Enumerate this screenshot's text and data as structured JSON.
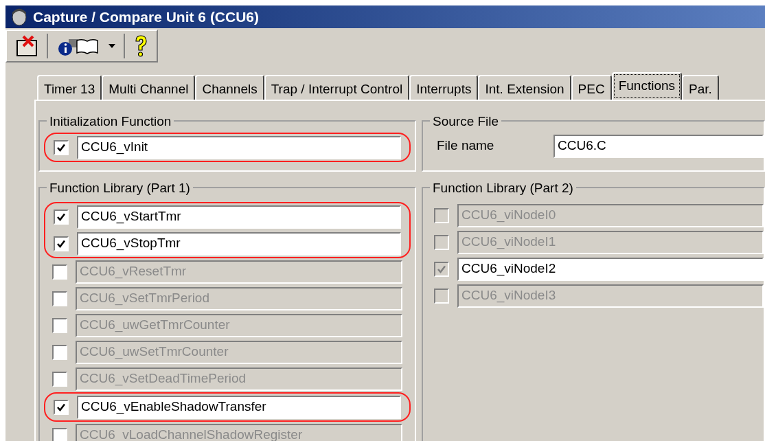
{
  "window": {
    "title": "Capture / Compare Unit 6 (CCU6)"
  },
  "tabs": [
    {
      "label": "Timer 13",
      "selected": false
    },
    {
      "label": "Multi Channel",
      "selected": false
    },
    {
      "label": "Channels",
      "selected": false
    },
    {
      "label": "Trap / Interrupt Control",
      "selected": false
    },
    {
      "label": "Interrupts",
      "selected": false
    },
    {
      "label": "Int. Extension",
      "selected": false
    },
    {
      "label": "PEC",
      "selected": false
    },
    {
      "label": "Functions",
      "selected": true
    },
    {
      "label": "Par.",
      "selected": false
    }
  ],
  "initialization": {
    "title": "Initialization Function",
    "rows": [
      {
        "name": "CCU6_vInit",
        "checked": true,
        "disabled": false,
        "highlighted": true
      }
    ]
  },
  "source_file": {
    "title": "Source File",
    "label": "File name",
    "value": "CCU6.C"
  },
  "library_part1": {
    "title": "Function Library (Part 1)",
    "rows": [
      {
        "name": "CCU6_vStartTmr",
        "checked": true,
        "disabled": false,
        "highlighted": true
      },
      {
        "name": "CCU6_vStopTmr",
        "checked": true,
        "disabled": false,
        "highlighted": true
      },
      {
        "name": "CCU6_vResetTmr",
        "checked": false,
        "disabled": false,
        "highlighted": false
      },
      {
        "name": "CCU6_vSetTmrPeriod",
        "checked": false,
        "disabled": false,
        "highlighted": false
      },
      {
        "name": "CCU6_uwGetTmrCounter",
        "checked": false,
        "disabled": false,
        "highlighted": false
      },
      {
        "name": "CCU6_uwSetTmrCounter",
        "checked": false,
        "disabled": false,
        "highlighted": false
      },
      {
        "name": "CCU6_vSetDeadTimePeriod",
        "checked": false,
        "disabled": false,
        "highlighted": false
      },
      {
        "name": "CCU6_vEnableShadowTransfer",
        "checked": true,
        "disabled": false,
        "highlighted": true
      },
      {
        "name": "CCU6_vLoadChannelShadowRegister",
        "checked": false,
        "disabled": false,
        "highlighted": false
      }
    ]
  },
  "library_part2": {
    "title": "Function Library (Part 2)",
    "rows": [
      {
        "name": "CCU6_viNodeI0",
        "checked": false,
        "disabled": true,
        "highlighted": false
      },
      {
        "name": "CCU6_viNodeI1",
        "checked": false,
        "disabled": true,
        "highlighted": false
      },
      {
        "name": "CCU6_viNodeI2",
        "checked": true,
        "disabled": true,
        "highlighted": false
      },
      {
        "name": "CCU6_viNodeI3",
        "checked": false,
        "disabled": true,
        "highlighted": false
      }
    ]
  }
}
